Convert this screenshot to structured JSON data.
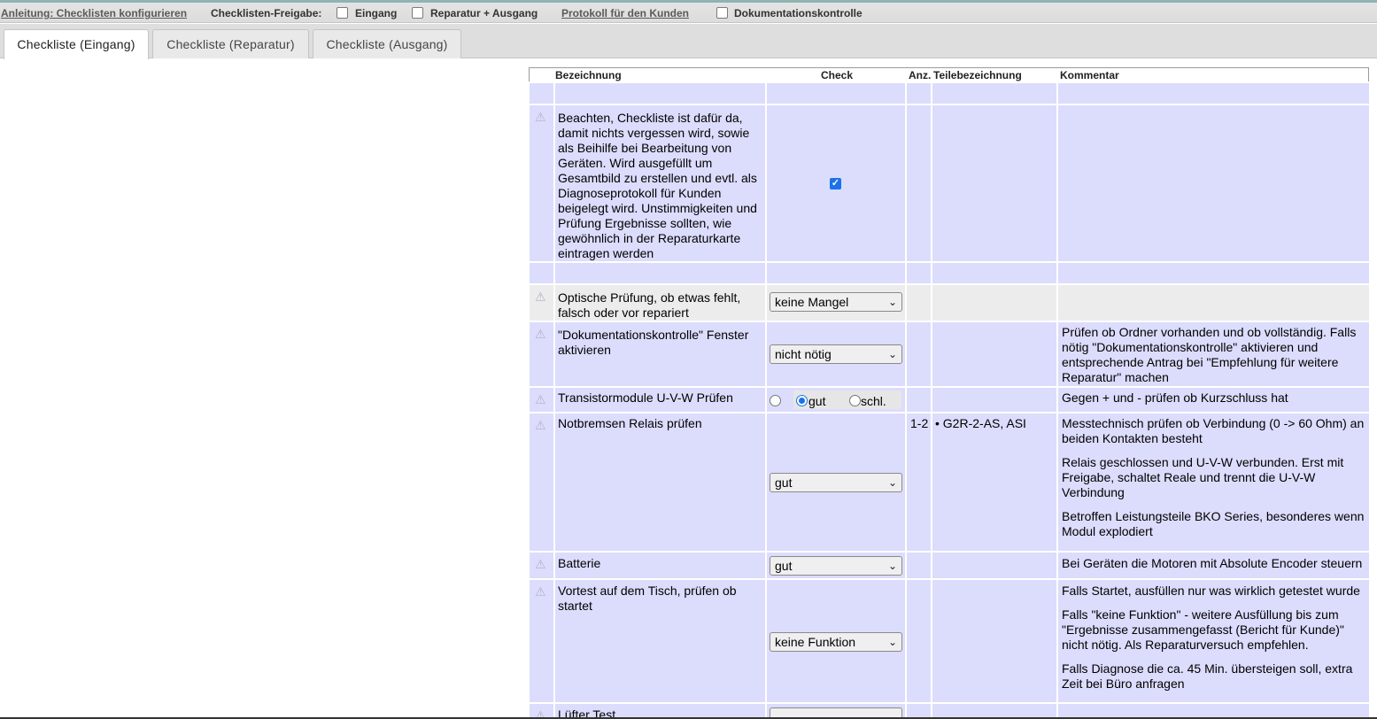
{
  "topbar": {
    "help_link": "Anleitung: Checklisten konfigurieren",
    "release_label": "Checklisten-Freigabe:",
    "cb_eingang": "Eingang",
    "cb_reparatur": "Reparatur + Ausgang",
    "protocol_link": "Protokoll für den Kunden",
    "cb_doku": "Dokumentationskontrolle"
  },
  "tabs": [
    {
      "label": "Checkliste (Eingang)"
    },
    {
      "label": "Checkliste (Reparatur)"
    },
    {
      "label": "Checkliste (Ausgang)"
    }
  ],
  "table": {
    "headers": {
      "bezeichnung": "Bezeichnung",
      "check": "Check",
      "anz": "Anz.",
      "teile": "Teilebezeichnung",
      "kommentar": "Kommentar"
    },
    "warn_icon": "warning-triangle-icon",
    "checkmark": "✓",
    "chevron": "⌄",
    "rows": [
      {
        "text": "Beachten, Checkliste ist dafür da, damit nichts vergessen wird, sowie als Beihilfe bei Bearbeitung von Geräten. Wird ausgefüllt um Gesamtbild zu erstellen und evtl. als Diagnoseprotokoll für Kunden beigelegt wird. Unstimmigkeiten und Prüfung Ergebnisse sollten, wie gewöhnlich in der Reparaturkarte eintragen werden",
        "checked": true
      },
      {
        "text": "Optische Prüfung, ob etwas fehlt, falsch oder vor repariert",
        "select": "keine Mangel"
      },
      {
        "text": "\"Dokumentationskontrolle\" Fenster aktivieren",
        "select": "nicht nötig",
        "comment": "Prüfen ob Ordner vorhanden und ob vollständig. Falls nötig \"Dokumentationskontrolle\" aktivieren und entsprechende Antrag bei \"Empfehlung für weitere Reparatur\" machen"
      },
      {
        "text": "Transistormodule U-V-W Prüfen",
        "radio_good": "gut",
        "radio_bad": "schl.",
        "radio_selected": "gut",
        "comment": "Gegen + und - prüfen ob Kurzschluss hat"
      },
      {
        "text": "Notbremsen Relais prüfen",
        "select": "gut",
        "anz": "1-2",
        "parts": "• G2R-2-AS, ASI",
        "comments": [
          "Messtechnisch prüfen ob Verbindung (0 -> 60 Ohm) an beiden Kontakten besteht",
          "Relais geschlossen und  U-V-W verbunden. Erst mit Freigabe, schaltet Reale und trennt die U-V-W Verbindung",
          "Betroffen Leistungsteile BKO Series, besonderes wenn Modul explodiert"
        ]
      },
      {
        "text": "Batterie",
        "select": "gut",
        "comment": "Bei Geräten die Motoren mit Absolute Encoder steuern"
      },
      {
        "text": "Vortest auf dem Tisch, prüfen ob startet",
        "select": "keine Funktion",
        "comments": [
          "Falls Startet, ausfüllen nur was wirklich getestet wurde",
          "Falls \"keine Funktion\" - weitere Ausfüllung bis zum \"Ergebnisse zusammengefasst (Bericht für Kunde)\" nicht nötig. Als Reparaturversuch empfehlen.",
          "Falls Diagnose die ca. 45 Min. übersteigen soll, extra Zeit bei Büro anfragen"
        ]
      },
      {
        "text": "Lüfter Test"
      }
    ]
  }
}
